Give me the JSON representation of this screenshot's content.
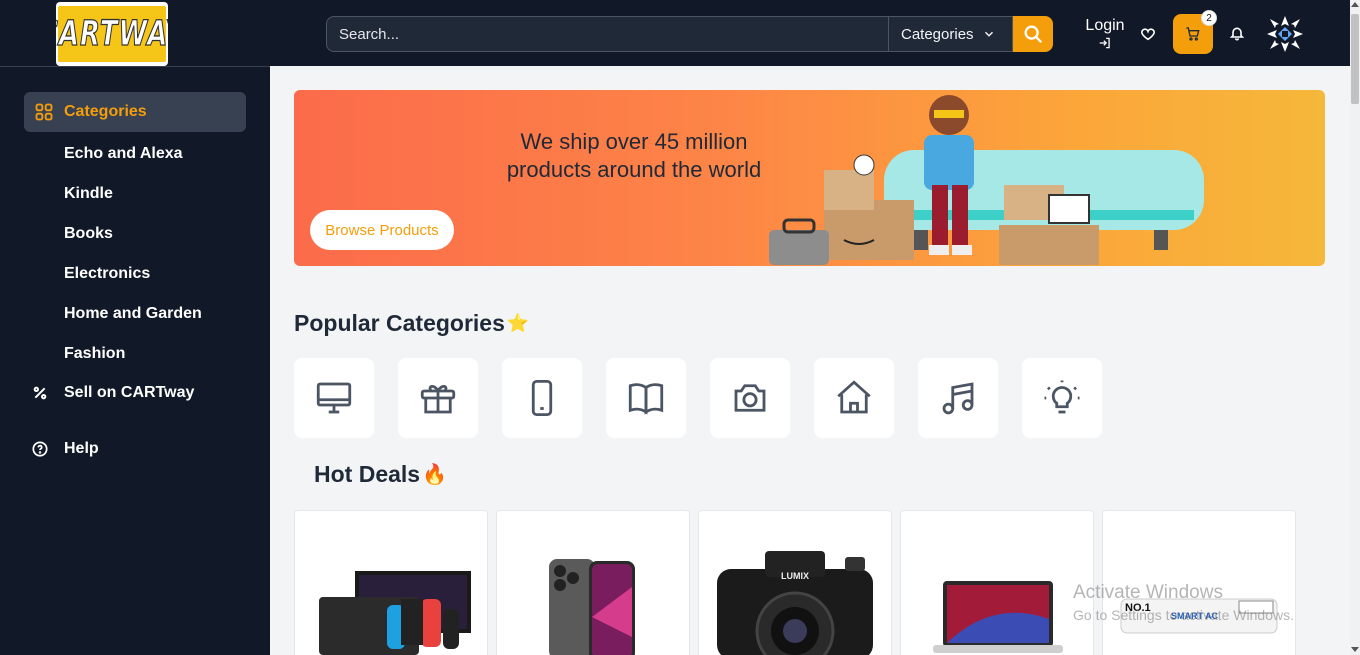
{
  "header": {
    "logo_text": "CARTWAY",
    "search_placeholder": "Search...",
    "categories_label": "Categories",
    "login_label": "Login",
    "cart_count": "2"
  },
  "sidebar": {
    "active_label": "Categories",
    "items": [
      "Echo and Alexa",
      "Kindle",
      "Books",
      "Electronics",
      "Home and Garden",
      "Fashion"
    ],
    "sell_label": "Sell on CARTway",
    "help_label": "Help"
  },
  "banner": {
    "line1": "We ship over 45 million",
    "line2": "products around the world",
    "button_label": "Browse Products"
  },
  "popular": {
    "title": "Popular Categories",
    "title_emoji": "⭐",
    "category_icons": [
      "monitor-icon",
      "gift-icon",
      "smartphone-icon",
      "book-icon",
      "camera-icon",
      "home-icon",
      "music-icon",
      "lightbulb-icon"
    ]
  },
  "hot_deals": {
    "title": "Hot Deals",
    "title_emoji": "🔥",
    "products": [
      {
        "image": "nintendo-switch-image"
      },
      {
        "image": "iphone-image"
      },
      {
        "image": "lumix-camera-image",
        "brand_text": "LUMIX"
      },
      {
        "image": "macbook-image"
      },
      {
        "image": "air-conditioner-image",
        "label_no1": "NO.1",
        "label_smart": "SMART AC"
      }
    ]
  },
  "watermark": {
    "line1": "Activate Windows",
    "line2": "Go to Settings to activate Windows."
  },
  "colors": {
    "header_bg": "#111827",
    "accent": "#f59e0b",
    "page_bg": "#f3f4f6"
  }
}
